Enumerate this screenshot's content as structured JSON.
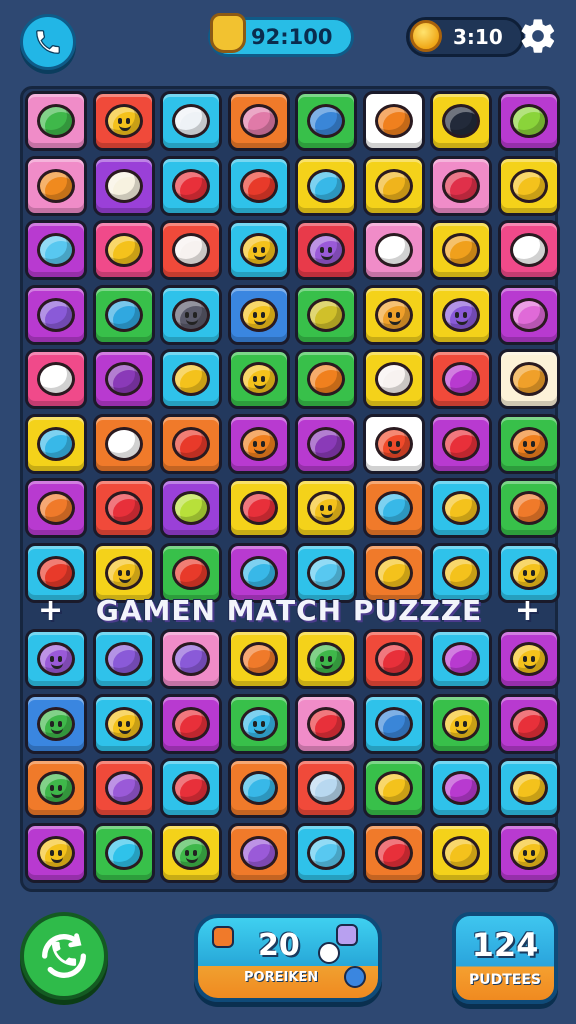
{
  "header": {
    "score_label": "92:100",
    "timer_label": "3:10",
    "call_icon": "phone-icon",
    "settings_icon": "gear-icon",
    "coin_icon": "coin-icon",
    "score_icon": "trophy-badge-icon"
  },
  "title": {
    "text": "GAMEN MATCH PUZZZE",
    "left_symbol": "+",
    "right_symbol": "+"
  },
  "footer": {
    "power_value": "20",
    "power_label": "POREIKEN",
    "moves_value": "124",
    "moves_label": "PUDTEES",
    "call_icon": "phone-refresh-icon"
  },
  "board_top": [
    [
      {
        "bg": "#f08cc8",
        "fg": "#3fb84a",
        "icon": "pickle-icon"
      },
      {
        "bg": "#f04a3a",
        "fg": "#f4c21c",
        "icon": "lemon-face-icon"
      },
      {
        "bg": "#2fc2ea",
        "fg": "#eef2f6",
        "icon": "cross-icon"
      },
      {
        "bg": "#f07a2a",
        "fg": "#e07aa8",
        "icon": "gum-icon"
      },
      {
        "bg": "#38c04a",
        "fg": "#3a86d8",
        "icon": "bird-icon"
      },
      {
        "bg": "#ffffff",
        "fg": "#f0801e",
        "icon": "bread-icon"
      },
      {
        "bg": "#f4d21a",
        "fg": "#222a3a",
        "icon": "pen-icon"
      },
      {
        "bg": "#b83ad0",
        "fg": "#8ad43a",
        "icon": "apple-icon"
      }
    ],
    [
      {
        "bg": "#f08cc8",
        "fg": "#f08a1e",
        "icon": "carrot-icon"
      },
      {
        "bg": "#9a40d8",
        "fg": "#f7f2e0",
        "icon": "bunny-icon"
      },
      {
        "bg": "#2fc2ea",
        "fg": "#e8303a",
        "icon": "starfish-icon"
      },
      {
        "bg": "#2fc2ea",
        "fg": "#e83a2a",
        "icon": "tomato-icon"
      },
      {
        "bg": "#f4d21a",
        "fg": "#38b8e8",
        "icon": "jelly-icon"
      },
      {
        "bg": "#f4d21a",
        "fg": "#f0b41c",
        "icon": "cat-icon"
      },
      {
        "bg": "#f08cc8",
        "fg": "#e0304a",
        "icon": "flag-icon"
      },
      {
        "bg": "#f4d21a",
        "fg": "#f4c21c",
        "icon": "lemon-icon"
      }
    ],
    [
      {
        "bg": "#b83ad0",
        "fg": "#58c8f0",
        "icon": "crystal-icon"
      },
      {
        "bg": "#f04a8a",
        "fg": "#f4c21c",
        "icon": "chick-icon"
      },
      {
        "bg": "#f04a3a",
        "fg": "#f7f2f0",
        "icon": "marshmallow-icon"
      },
      {
        "bg": "#2fc2ea",
        "fg": "#f4c21c",
        "icon": "smiley-icon"
      },
      {
        "bg": "#e83a4a",
        "fg": "#9a5ad8",
        "icon": "cat-face-icon"
      },
      {
        "bg": "#f08cc8",
        "fg": "#ffffff",
        "icon": "heart-icon"
      },
      {
        "bg": "#f4d21a",
        "fg": "#f0a01c",
        "icon": "cheese-icon"
      },
      {
        "bg": "#f04a8a",
        "fg": "#ffffff",
        "icon": "shield-icon"
      }
    ],
    [
      {
        "bg": "#b83ad0",
        "fg": "#8a5ad8",
        "icon": "robot-icon"
      },
      {
        "bg": "#38c04a",
        "fg": "#30a8e0",
        "icon": "fish-icon"
      },
      {
        "bg": "#2fc2ea",
        "fg": "#5a5a6a",
        "icon": "rock-face-icon"
      },
      {
        "bg": "#3a86e0",
        "fg": "#f4c21c",
        "icon": "smiley-icon"
      },
      {
        "bg": "#38c04a",
        "fg": "#d0c02a",
        "icon": "olive-icon"
      },
      {
        "bg": "#f4d21a",
        "fg": "#f0a02a",
        "icon": "orange-face-icon"
      },
      {
        "bg": "#f4d21a",
        "fg": "#8a5ad8",
        "icon": "plum-face-icon"
      },
      {
        "bg": "#b83ad0",
        "fg": "#e06ad8",
        "icon": "grape-icon"
      }
    ],
    [
      {
        "bg": "#f04a8a",
        "fg": "#ffffff",
        "icon": "heart-icon"
      },
      {
        "bg": "#b83ad0",
        "fg": "#8a3ab8",
        "icon": "eggplant-icon"
      },
      {
        "bg": "#2fc2ea",
        "fg": "#f4c21c",
        "icon": "star-note-icon"
      },
      {
        "bg": "#38c04a",
        "fg": "#f4c21c",
        "icon": "smiley-icon"
      },
      {
        "bg": "#38c04a",
        "fg": "#f0801e",
        "icon": "leaf-burst-icon"
      },
      {
        "bg": "#f4d21a",
        "fg": "#f7f2f0",
        "icon": "ghost-icon"
      },
      {
        "bg": "#f04a3a",
        "fg": "#b83ad0",
        "icon": "heart-fruit-icon"
      },
      {
        "bg": "#fdf2d8",
        "fg": "#f0a02a",
        "icon": "cow-icon"
      }
    ],
    [
      {
        "bg": "#f4d21a",
        "fg": "#38b8e8",
        "icon": "drop-icon"
      },
      {
        "bg": "#f07a2a",
        "fg": "#ffffff",
        "icon": "glove-icon"
      },
      {
        "bg": "#f07a2a",
        "fg": "#e83a2a",
        "icon": "apple-icon"
      },
      {
        "bg": "#b83ad0",
        "fg": "#f0801e",
        "icon": "bird-face-icon"
      },
      {
        "bg": "#b83ad0",
        "fg": "#8a3ab8",
        "icon": "snail-icon"
      },
      {
        "bg": "#ffffff",
        "fg": "#f04a2a",
        "icon": "devil-face-icon"
      },
      {
        "bg": "#b83ad0",
        "fg": "#e8303a",
        "icon": "cherry-icon"
      },
      {
        "bg": "#38c04a",
        "fg": "#f0801e",
        "icon": "fox-face-icon"
      }
    ],
    [
      {
        "bg": "#b83ad0",
        "fg": "#f07a2a",
        "icon": "crab-icon"
      },
      {
        "bg": "#f04a3a",
        "fg": "#e8303a",
        "icon": "card-icon"
      },
      {
        "bg": "#9a40d8",
        "fg": "#b8e03a",
        "icon": "candy-bar-icon"
      },
      {
        "bg": "#f4d21a",
        "fg": "#e8303a",
        "icon": "heart-icon"
      },
      {
        "bg": "#f4d21a",
        "fg": "#f4c21c",
        "icon": "smiley-icon"
      },
      {
        "bg": "#f07a2a",
        "fg": "#38b8e8",
        "icon": "bottle-icon"
      },
      {
        "bg": "#2fc2ea",
        "fg": "#f4c21c",
        "icon": "duck-icon"
      },
      {
        "bg": "#38c04a",
        "fg": "#f07a2a",
        "icon": "carrot-icon"
      }
    ],
    [
      {
        "bg": "#2fc2ea",
        "fg": "#e83a2a",
        "icon": "starfish-icon"
      },
      {
        "bg": "#f4d21a",
        "fg": "#f4c21c",
        "icon": "lemon-face-icon"
      },
      {
        "bg": "#38c04a",
        "fg": "#e83a2a",
        "icon": "tomato-icon"
      },
      {
        "bg": "#b83ad0",
        "fg": "#38b8e8",
        "icon": "fish-icon"
      },
      {
        "bg": "#2fc2ea",
        "fg": "#58c8f0",
        "icon": "jelly-icon"
      },
      {
        "bg": "#f07a2a",
        "fg": "#f4c21c",
        "icon": "pencil-icon"
      },
      {
        "bg": "#2fc2ea",
        "fg": "#f4c21c",
        "icon": "duck-icon"
      },
      {
        "bg": "#2fc2ea",
        "fg": "#f4c21c",
        "icon": "cat-face-icon"
      }
    ]
  ],
  "board_bottom": [
    [
      {
        "bg": "#2fc2ea",
        "fg": "#9a5ad8",
        "icon": "plum-face-icon"
      },
      {
        "bg": "#2fc2ea",
        "fg": "#8a5ad8",
        "icon": "leaf-icon"
      },
      {
        "bg": "#f08cc8",
        "fg": "#8a5ad8",
        "icon": "grape-icon"
      },
      {
        "bg": "#f4d21a",
        "fg": "#f07a2a",
        "icon": "orange-icon"
      },
      {
        "bg": "#f4d21a",
        "fg": "#3fb84a",
        "icon": "pear-face-icon"
      },
      {
        "bg": "#f04a3a",
        "fg": "#e8303a",
        "icon": "chili-icon"
      },
      {
        "bg": "#2fc2ea",
        "fg": "#b83ad0",
        "icon": "plum-icon"
      },
      {
        "bg": "#b83ad0",
        "fg": "#f4c21c",
        "icon": "lion-face-icon"
      }
    ],
    [
      {
        "bg": "#3a86e0",
        "fg": "#3fb84a",
        "icon": "lime-face-icon"
      },
      {
        "bg": "#2fc2ea",
        "fg": "#f4c21c",
        "icon": "star-face-icon"
      },
      {
        "bg": "#b83ad0",
        "fg": "#e8303a",
        "icon": "apple-icon"
      },
      {
        "bg": "#38c04a",
        "fg": "#38b8e8",
        "icon": "blueberry-face-icon"
      },
      {
        "bg": "#f08cc8",
        "fg": "#e8303a",
        "icon": "apple-icon"
      },
      {
        "bg": "#2fc2ea",
        "fg": "#3a86d8",
        "icon": "fish-icon"
      },
      {
        "bg": "#38c04a",
        "fg": "#f4c21c",
        "icon": "smiley-icon"
      },
      {
        "bg": "#b83ad0",
        "fg": "#e8303a",
        "icon": "apple-icon"
      }
    ],
    [
      {
        "bg": "#f07a2a",
        "fg": "#3fb84a",
        "icon": "pear-face-icon"
      },
      {
        "bg": "#f04a3a",
        "fg": "#9a5ad8",
        "icon": "monster-icon"
      },
      {
        "bg": "#2fc2ea",
        "fg": "#e8303a",
        "icon": "cherry-icon"
      },
      {
        "bg": "#f07a2a",
        "fg": "#38b8e8",
        "icon": "robot-arm-icon"
      },
      {
        "bg": "#f04a3a",
        "fg": "#b8d8f0",
        "icon": "surfboard-icon"
      },
      {
        "bg": "#38c04a",
        "fg": "#f4c21c",
        "icon": "duck-icon"
      },
      {
        "bg": "#2fc2ea",
        "fg": "#b83ad0",
        "icon": "eggplant-icon"
      },
      {
        "bg": "#2fc2ea",
        "fg": "#f4c21c",
        "icon": "chick-icon"
      }
    ],
    [
      {
        "bg": "#b83ad0",
        "fg": "#f4c21c",
        "icon": "lion-face-icon"
      },
      {
        "bg": "#38c04a",
        "fg": "#2fc2ea",
        "icon": "whale-icon"
      },
      {
        "bg": "#f4d21a",
        "fg": "#3fb84a",
        "icon": "lime-face-icon"
      },
      {
        "bg": "#f07a2a",
        "fg": "#9a5ad8",
        "icon": "monster-icon"
      },
      {
        "bg": "#2fc2ea",
        "fg": "#58c8f0",
        "icon": "jelly-icon"
      },
      {
        "bg": "#f07a2a",
        "fg": "#e8303a",
        "icon": "apple-icon"
      },
      {
        "bg": "#f4d21a",
        "fg": "#f4c21c",
        "icon": "duck-icon"
      },
      {
        "bg": "#b83ad0",
        "fg": "#f4c21c",
        "icon": "lion-face-icon"
      }
    ]
  ],
  "colors": {
    "background": "#2e4872",
    "board": "#23395e",
    "accent_cyan": "#28bde6",
    "accent_green": "#2fbb4a",
    "accent_orange": "#f08a20"
  }
}
